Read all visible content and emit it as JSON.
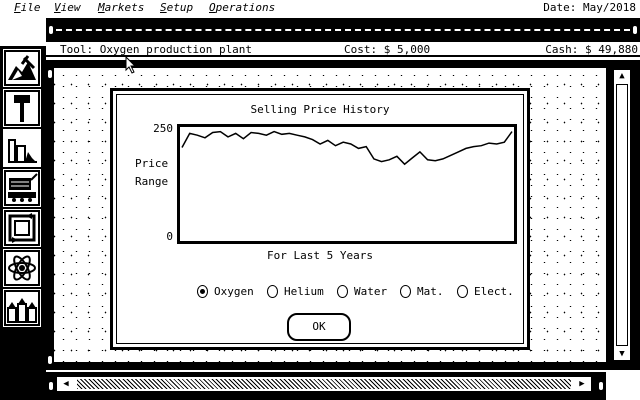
{
  "menubar": {
    "items": [
      {
        "pre": "",
        "u": "F",
        "post": "ile"
      },
      {
        "pre": "",
        "u": "V",
        "post": "iew"
      },
      {
        "pre": "",
        "u": "M",
        "post": "arkets"
      },
      {
        "pre": "",
        "u": "S",
        "post": "etup"
      },
      {
        "pre": "",
        "u": "O",
        "post": "perations"
      }
    ],
    "date": "Date: May/2018"
  },
  "status": {
    "tool": "Tool: Oxygen production plant",
    "cost": "Cost: $ 5,000",
    "cash": "Cash: $ 49,880"
  },
  "toolbar": {
    "tools": [
      "mining-tool-icon",
      "hammer-tool-icon",
      "production-plant-icon",
      "transport-vehicle-icon",
      "recycle-icon",
      "atom-research-icon",
      "habitat-buildings-icon"
    ],
    "active_index": 2
  },
  "dialog": {
    "title": "Selling Price History",
    "ylabel_line1": "Price",
    "ylabel_line2": "Range",
    "tick_top": "250",
    "tick_bottom": "0",
    "xlabel": "For Last 5 Years",
    "radios": [
      {
        "label": "Oxygen",
        "selected": true
      },
      {
        "label": "Helium",
        "selected": false
      },
      {
        "label": "Water",
        "selected": false
      },
      {
        "label": "Mat.",
        "selected": false
      },
      {
        "label": "Elect.",
        "selected": false
      }
    ],
    "ok_label": "OK"
  },
  "chart_data": {
    "type": "line",
    "title": "Selling Price History",
    "xlabel": "For Last 5 Years",
    "ylabel": "Price Range",
    "ylim": [
      0,
      250
    ],
    "yticks": [
      "0",
      "250"
    ],
    "grid": false,
    "series": [
      {
        "name": "Oxygen",
        "values": [
          208,
          240,
          236,
          230,
          242,
          244,
          232,
          240,
          228,
          242,
          240,
          236,
          244,
          238,
          240,
          236,
          232,
          226,
          216,
          224,
          212,
          220,
          216,
          206,
          210,
          182,
          176,
          180,
          188,
          170,
          184,
          198,
          180,
          178,
          182,
          190,
          198,
          206,
          210,
          212,
          218,
          216,
          220,
          244
        ]
      }
    ]
  }
}
